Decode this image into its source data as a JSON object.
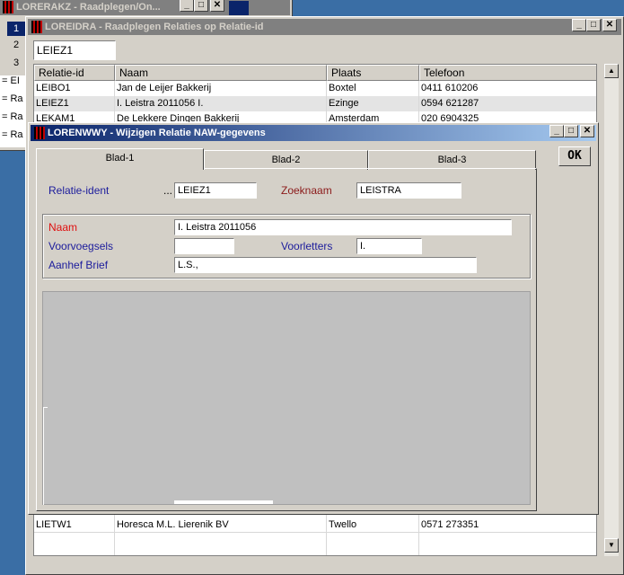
{
  "win_back": {
    "title": "LORERAKZ - Raadplegen/On...",
    "rows": [
      "1",
      "2",
      "3"
    ],
    "side_labels": [
      "= EI",
      "= Ra",
      "= Ra",
      "= Ra"
    ]
  },
  "win_mid": {
    "title": "LOREIDRA - Raadplegen Relaties op Relatie-id",
    "search_value": "LEIEZ1",
    "columns": [
      "Relatie-id",
      "Naam",
      "Plaats",
      "Telefoon"
    ],
    "rows": [
      [
        "LEIBO1",
        "Jan de Leijer Bakkerij",
        "Boxtel",
        "0411 610206"
      ],
      [
        "LEIEZ1",
        "I. Leistra 2011056 I.",
        "Ezinge",
        "0594 621287"
      ],
      [
        "LEKAM1",
        "De Lekkere Dingen Bakkerij",
        "Amsterdam",
        "020 6904325"
      ]
    ],
    "bottom_row": [
      "LIETW1",
      "Horesca M.L. Lierenik BV",
      "Twello",
      "0571 273351"
    ]
  },
  "win_front": {
    "title": "LORENWWY - Wijzigen Relatie NAW-gegevens",
    "tabs": [
      "Blad-1",
      "Blad-2",
      "Blad-3"
    ],
    "ok_label": "OK",
    "relatie_ident_label": "Relatie-ident",
    "relatie_ident_dots": "...",
    "relatie_ident_value": "LEIEZ1",
    "zoeknaam_label": "Zoeknaam",
    "zoeknaam_value": "LEISTRA",
    "naam_label": "Naam",
    "naam_value": "I. Leistra 2011056",
    "voorvoegsels_label": "Voorvoegsels",
    "voorvoegsels_value": "",
    "voorletters_label": "Voorletters",
    "voorletters_value": "I.",
    "aanhef_label": "Aanhef Brief",
    "aanhef_value": "L.S.,"
  },
  "colors": {
    "desktop": "#3a6ea5",
    "window_face": "#d4d0c8",
    "title_active_start": "#0a246a",
    "title_active_end": "#a6caf0",
    "title_inactive": "#808080",
    "label_blue": "#1c1c9c",
    "label_red": "#e01010",
    "label_darkred": "#8b1a1a"
  },
  "icons": [
    "system-menu-icon",
    "minimize-icon",
    "maximize-icon",
    "close-icon",
    "scroll-up-arrow-icon",
    "scroll-down-arrow-icon"
  ]
}
